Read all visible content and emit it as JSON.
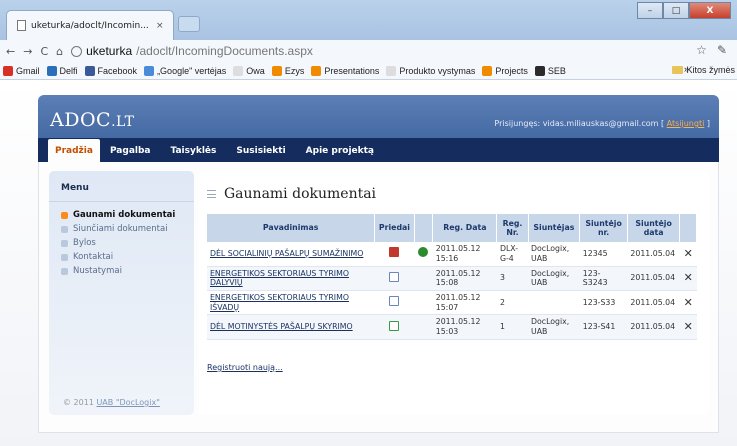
{
  "browser": {
    "tab_title": "uketurka/adoclt/Incomin...",
    "tab_close": "×",
    "url_host": "uketurka",
    "url_path": "/adoclt/IncomingDocuments.aspx",
    "win_min": "–",
    "win_max": "□",
    "win_close": "X",
    "bookmarks": [
      {
        "label": "Gmail",
        "color": "#d93025"
      },
      {
        "label": "Delfi",
        "color": "#2a6fb8"
      },
      {
        "label": "Facebook",
        "color": "#3b5998"
      },
      {
        "label": "„Google\" vertėjas",
        "color": "#4a8ad8"
      },
      {
        "label": "Owa",
        "color": "#dddddd"
      },
      {
        "label": "Ezys",
        "color": "#f08a00"
      },
      {
        "label": "Presentations",
        "color": "#f08a00"
      },
      {
        "label": "Produkto vystymas",
        "color": "#dddddd"
      },
      {
        "label": "Projects",
        "color": "#f08a00"
      },
      {
        "label": "SEB",
        "color": "#2b2b2b"
      }
    ],
    "bookmarks_more": "»",
    "other_bookmarks": "Kitos žymės"
  },
  "site": {
    "logo": "ADOC",
    "logo_suffix": ".LT",
    "login_prefix": "Prisijungęs: vidas.miliauskas@gmail.com [",
    "logout": "Atsijungti",
    "login_suffix": "]",
    "menu": [
      {
        "label": "Pradžia",
        "active": true
      },
      {
        "label": "Pagalba"
      },
      {
        "label": "Taisyklės"
      },
      {
        "label": "Susisiekti"
      },
      {
        "label": "Apie projektą"
      }
    ]
  },
  "sidebar": {
    "heading": "Menu",
    "items": [
      {
        "label": "Gaunami dokumentai",
        "active": true
      },
      {
        "label": "Siunčiami dokumentai"
      },
      {
        "label": "Bylos"
      },
      {
        "label": "Kontaktai"
      },
      {
        "label": "Nustatymai"
      }
    ],
    "footer_prefix": "© 2011",
    "footer_link": "UAB \"DocLogix\""
  },
  "content": {
    "title": "Gaunami dokumentai",
    "columns": [
      "Pavadinimas",
      "Priedai",
      "",
      "Reg. Data",
      "Reg. Nr.",
      "Siuntėjas",
      "Siuntėjo nr.",
      "Siuntėjo data",
      ""
    ],
    "rows": [
      {
        "name": "DĖL SOCIALINIŲ PAŠALPŲ SUMAŽINIMO",
        "attachment": "red",
        "signed": true,
        "reg_date": "2011.05.12 15:16",
        "reg_nr": "DLX-G-4",
        "sender": "DocLogix, UAB",
        "sender_nr": "12345",
        "sender_date": "2011.05.04",
        "delete": "✕"
      },
      {
        "name": "ENERGETIKOS SEKTORIAUS TYRIMO DALYVIŲ",
        "attachment": "doc",
        "signed": false,
        "reg_date": "2011.05.12 15:08",
        "reg_nr": "3",
        "sender": "DocLogix, UAB",
        "sender_nr": "123-S3243",
        "sender_date": "2011.05.04",
        "delete": "✕"
      },
      {
        "name": "ENERGETIKOS SEKTORIAUS TYRIMO IŠVADŲ",
        "attachment": "doc",
        "signed": false,
        "reg_date": "2011.05.12 15:07",
        "reg_nr": "2",
        "sender": "",
        "sender_nr": "123-S33",
        "sender_date": "2011.05.04",
        "delete": "✕"
      },
      {
        "name": "DĖL MOTINYSTĖS PAŠALPŲ SKYRIMO",
        "attachment": "green",
        "signed": false,
        "reg_date": "2011.05.12 15:03",
        "reg_nr": "1",
        "sender": "DocLogix, UAB",
        "sender_nr": "123-S41",
        "sender_date": "2011.05.04",
        "delete": "✕"
      }
    ],
    "register_link": "Registruoti naują..."
  }
}
